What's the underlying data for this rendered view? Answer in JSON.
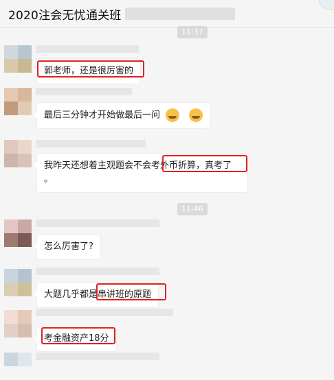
{
  "header": {
    "title": "2020注会无忧通关班",
    "accent": "#e02020"
  },
  "timestamps": [
    "11:37",
    "11:46"
  ],
  "messages": [
    {
      "text": "郭老师，还是很厉害的"
    },
    {
      "text": "最后三分钟才开始做最后一问",
      "emojis": [
        "laugh-cry-emoji",
        "laugh-cry-emoji"
      ]
    },
    {
      "text_line1": "我昨天还想着主观题会不会考外币折算，真考了",
      "text_line2": "。"
    },
    {
      "text": "怎么厉害了?"
    },
    {
      "text": "大题几乎都是串讲班的原题"
    },
    {
      "text": "考金融资产18分"
    }
  ]
}
